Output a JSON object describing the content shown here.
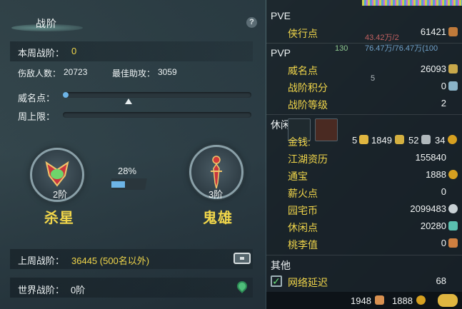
{
  "panel": {
    "title": "战阶",
    "help": "?",
    "weekly_rank_label": "本周战阶：",
    "weekly_rank_value": "0",
    "kills_label": "伤敌人数：",
    "kills_value": "20723",
    "assist_label": "最佳助攻：",
    "assist_value": "3059",
    "fame_label": "威名点：",
    "fame_progress": 0.03,
    "fame_marker": 0.35,
    "weekly_cap_label": "周上限：",
    "left_medal": {
      "name": "杀星",
      "rank": "2阶"
    },
    "right_medal": {
      "name": "鬼雄",
      "rank": "3阶"
    },
    "progress_pct": "28%",
    "last_week_label": "上周战阶：",
    "last_week_value": "36445 (500名以外)",
    "world_label": "世界战阶：",
    "world_value": "0阶"
  },
  "right_panel": {
    "sections": {
      "pve": "PVE",
      "pvp": "PVP",
      "leisure": "休闲",
      "other": "其他"
    },
    "pve_rows": [
      {
        "label": "侠行点",
        "value": "61421"
      }
    ],
    "pvp_rows": [
      {
        "label": "威名点",
        "value": "26093"
      },
      {
        "label": "战阶积分",
        "value": "0"
      },
      {
        "label": "战阶等级",
        "value": "2"
      }
    ],
    "money": {
      "label": "金钱:",
      "gold": "5",
      "silver": "1849",
      "copper1": "52",
      "copper2": "34"
    },
    "leisure_rows": [
      {
        "label": "江湖资历",
        "value": "155840"
      },
      {
        "label": "通宝",
        "value": "1888"
      },
      {
        "label": "薪火点",
        "value": "0"
      },
      {
        "label": "园宅币",
        "value": "2099483"
      },
      {
        "label": "休闲点",
        "value": "20280"
      },
      {
        "label": "桃李值",
        "value": "0"
      }
    ],
    "other_rows": [
      {
        "label": "网络延迟",
        "value": "68",
        "checked": true
      }
    ]
  },
  "footer": {
    "value1": "1948",
    "value2": "1888"
  },
  "overlay": {
    "hp_text": "43.42万/2",
    "num_130": "130",
    "mp_text": "76.47万/76.47万(100",
    "num_5": "5"
  },
  "colors": {
    "accent": "#f1d64a",
    "bar": "#6db4e6",
    "panel": "#121a20"
  }
}
